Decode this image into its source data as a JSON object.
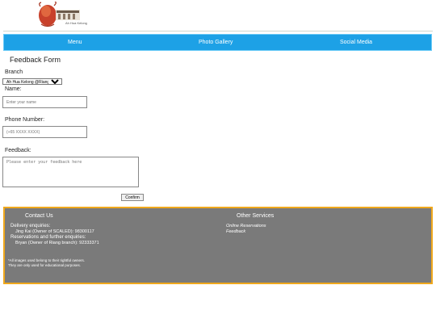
{
  "header": {
    "logo_text": "Ah Hua Kelong",
    "logo_icon": "lobster-logo-icon"
  },
  "nav": {
    "items": [
      "Menu",
      "Photo Gallery",
      "Social Media"
    ],
    "background": "#1da1e6"
  },
  "form": {
    "title": "Feedback Form",
    "branch_label": "Branch",
    "branch_selected": "Ah Hua Kelong @Riang",
    "name_label": "Name:",
    "name_placeholder": "Enter your name",
    "phone_label": "Phone Number:",
    "phone_placeholder": "(+65 XXXX XXXX)",
    "feedback_label": "Feedback:",
    "feedback_placeholder": "Please enter your feedback here",
    "confirm_label": "Confirm"
  },
  "footer": {
    "contact_heading": "Contact Us",
    "delivery_label": "Delivery enquiries:",
    "delivery_contact": "Jing Kai (Owner of SCALED): 98300117",
    "reservations_label": "Reservations and further enquiries:",
    "reservations_contact": "Bryan (Owner of Riang branch): 92333371",
    "disclaimer_1": "*All images used belong to their rightful owners.",
    "disclaimer_2": "They are only used for educational purposes.",
    "services_heading": "Other Services",
    "services": [
      "Online Reservations",
      "Feedback"
    ],
    "background": "#7a7a7a",
    "border": "#f0a81c"
  }
}
